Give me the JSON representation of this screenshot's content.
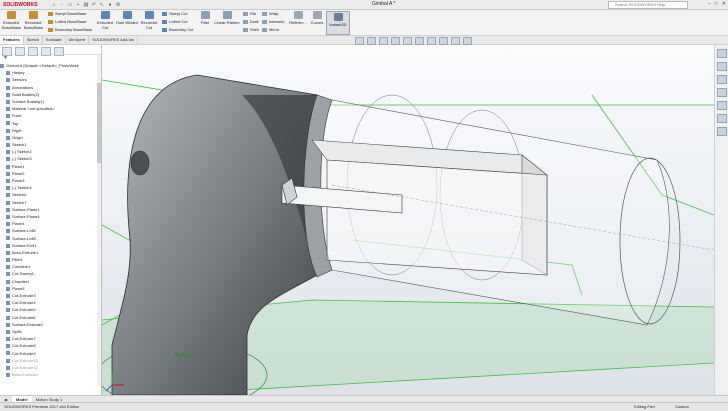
{
  "app": {
    "logo": "SOLIDWORKS",
    "title": "Gimbal A *",
    "search_placeholder": "Search SOLIDWORKS Help"
  },
  "ribbon": {
    "extruded_boss": "Extruded Boss/Base",
    "revolved_boss": "Revolved Boss/Base",
    "swept_boss": "Swept Boss/Base",
    "lofted_boss": "Lofted Boss/Base",
    "boundary_boss": "Boundary Boss/Base",
    "extruded_cut": "Extruded Cut",
    "hole_wizard": "Hole Wizard",
    "revolved_cut": "Revolved Cut",
    "swept_cut": "Swept Cut",
    "lofted_cut": "Lofted Cut",
    "boundary_cut": "Boundary Cut",
    "fillet": "Fillet",
    "linear_pattern": "Linear Pattern",
    "rib": "Rib",
    "draft": "Draft",
    "shell": "Shell",
    "wrap": "Wrap",
    "intersect": "Intersect",
    "mirror": "Mirror",
    "reference": "Referen...",
    "curves": "Curves",
    "instant3d": "Instant3D"
  },
  "command_tabs": [
    "Features",
    "Sketch",
    "Evaluate",
    "DimXpert",
    "SOLIDWORKS Add-Ins"
  ],
  "feature_tree": {
    "root": "Gimbal A (Default<<Default>_PhotoWork",
    "items": [
      "History",
      "Sensors",
      "Annotations",
      "Solid Bodies(2)",
      "Surface Bodies(1)",
      "Material <not specified>",
      "Front",
      "Top",
      "Right",
      "Origin",
      "Sketch1",
      "(-) Sketch2",
      "(-) Sketch3",
      "Plane1",
      "Plane2",
      "Plane3",
      "(-) Sketch4",
      "Sketch6",
      "Sketch7",
      "Surface-Plane1",
      "Surface-Plane4",
      "Plane4",
      "Surface-Loft1",
      "Surface-Loft2",
      "Surface-Knit1",
      "Boss-Extrude1",
      "Fillet1",
      "Combine1",
      "Cut-Sweep1",
      "Chamfer1",
      "Plane5",
      "Cut-Extrude3",
      "Cut-Extrude4",
      "Cut-Extrude5",
      "Cut-Extrude6",
      "Surface-Extrude1",
      "Split1",
      "Cut-Extrude7",
      "Cut-Extrude8",
      "Cut-Extrude9",
      "Cut-Extrude10",
      "Cut-Extrude11",
      "Boss-Extrude2"
    ],
    "gray_items": [
      "Cut-Extrude10",
      "Cut-Extrude11",
      "Boss-Extrude2"
    ]
  },
  "viewport": {
    "plane_label": "Plane2"
  },
  "bottom_tabs": [
    "Model",
    "Motion Study 1"
  ],
  "status": {
    "edition": "SOLIDWORKS Premium 2017 x64 Edition",
    "mode": "Editing Part",
    "units": "Custom"
  },
  "colors": {
    "accent": "#d6001c",
    "plane_green": "#3cc23c",
    "body_dark": "#4b4f52"
  },
  "icons": [
    "search-icon",
    "close-icon",
    "filter-icon",
    "expand-icon"
  ]
}
